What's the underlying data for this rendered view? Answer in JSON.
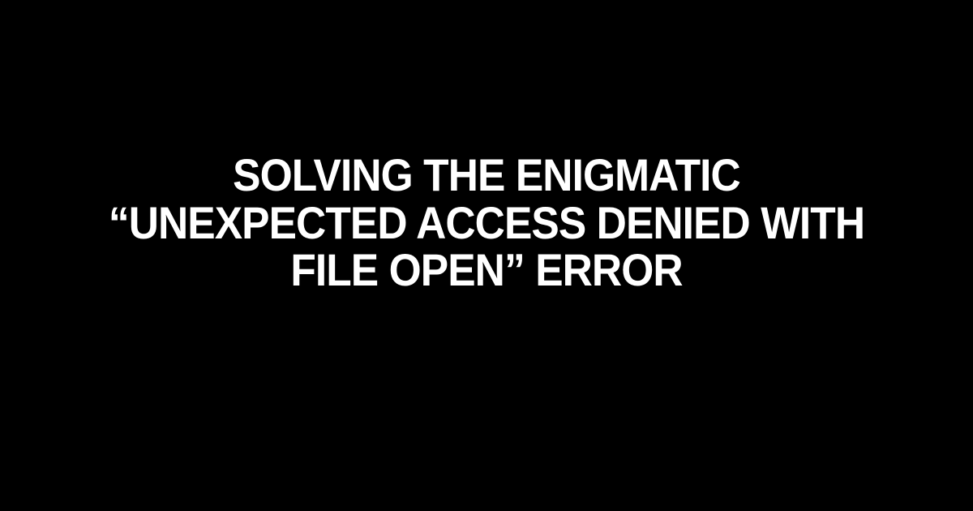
{
  "headline": "Solving the Enigmatic “Unexpected Access Denied with File Open” Error"
}
